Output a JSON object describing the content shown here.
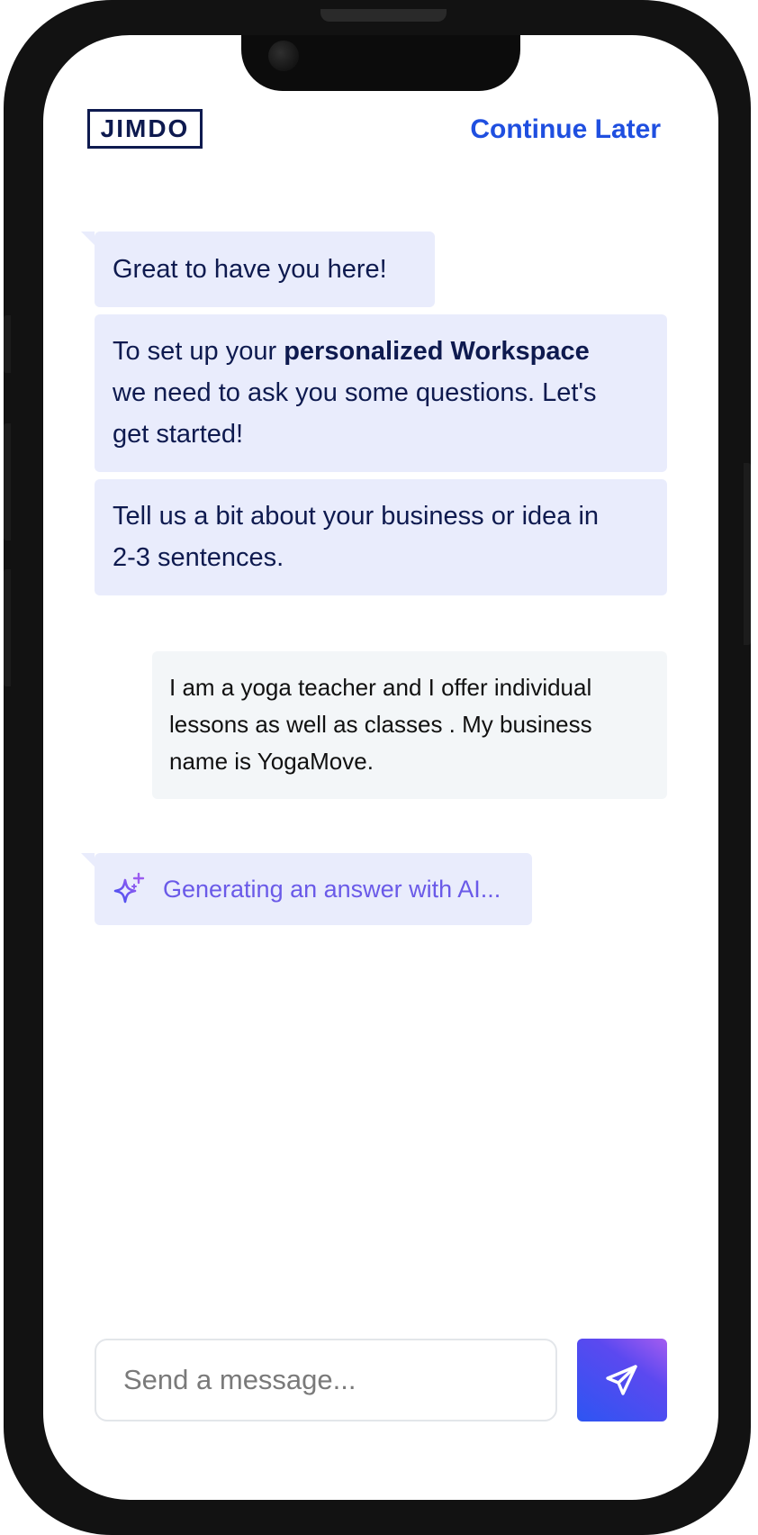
{
  "header": {
    "logo_text": "JIMDO",
    "continue_later": "Continue Later"
  },
  "chat": {
    "bot_message_1": "Great to have you here!",
    "bot_message_2_prefix": "To set up your ",
    "bot_message_2_bold": "personalized Workspace",
    "bot_message_2_line2": "we need to ask you some questions. Let's",
    "bot_message_2_line3": "get started!",
    "bot_message_3_line1": "Tell us a bit about your business or idea in",
    "bot_message_3_line2": "2-3 sentences.",
    "user_message_line1": "I am a yoga teacher and I offer individual",
    "user_message_line2": "lessons as well as classes . My business",
    "user_message_line3": "name is YogaMove.",
    "ai_status": "Generating an answer with AI..."
  },
  "composer": {
    "placeholder": "Send a message..."
  },
  "icons": {
    "ai_status_icon": "sparkle-icon",
    "send_icon": "paper-plane-icon"
  },
  "colors": {
    "brand_navy": "#0e1a4f",
    "accent_blue": "#1f4fe0",
    "bot_bubble": "#e9ecfc",
    "user_bubble": "#f3f6f8",
    "ai_text": "#6a5ae8"
  }
}
